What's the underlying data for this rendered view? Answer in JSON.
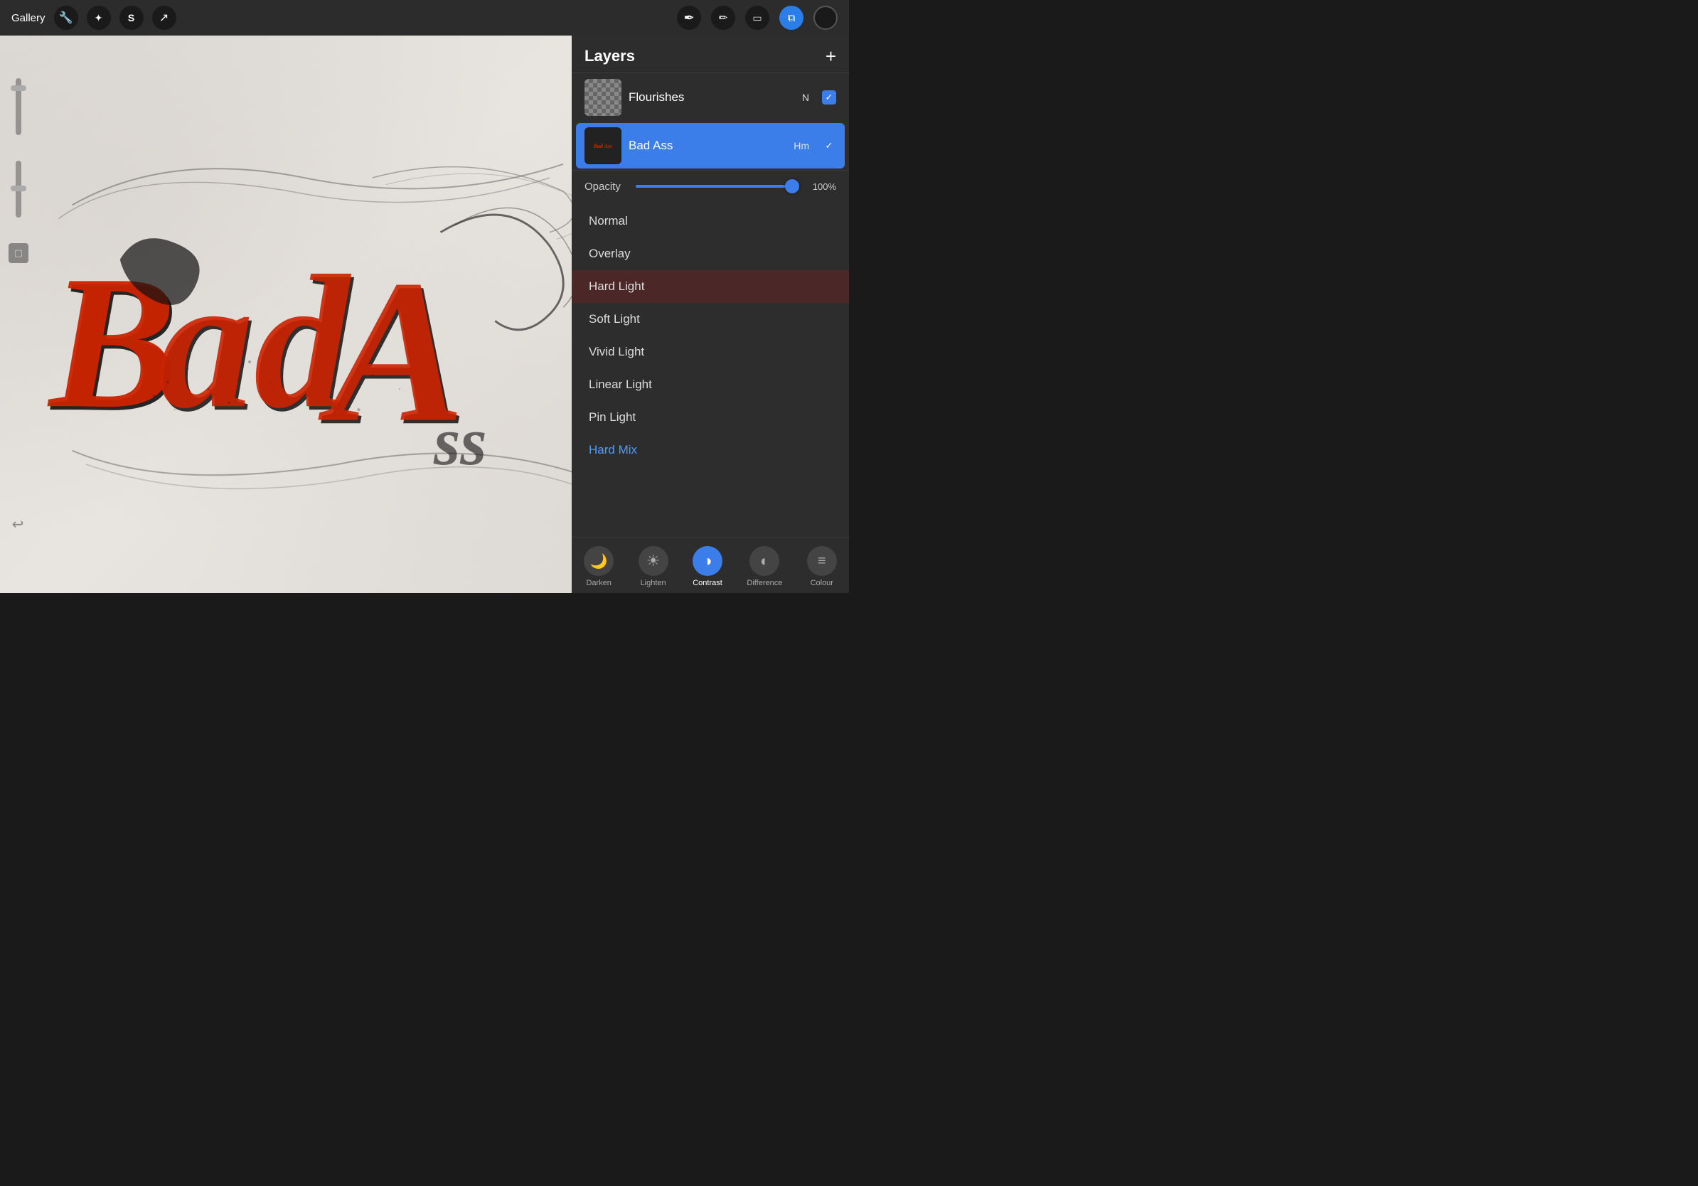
{
  "toolbar": {
    "gallery_label": "Gallery",
    "tools": [
      {
        "name": "wrench",
        "icon": "🔧",
        "active": false
      },
      {
        "name": "magic-wand",
        "icon": "✦",
        "active": false
      },
      {
        "name": "smudge",
        "icon": "S",
        "active": false
      },
      {
        "name": "cursor",
        "icon": "↗",
        "active": false
      }
    ],
    "right_tools": [
      {
        "name": "pen",
        "icon": "✒"
      },
      {
        "name": "eraser-pencil",
        "icon": "✏"
      },
      {
        "name": "eraser",
        "icon": "⬜"
      },
      {
        "name": "layers-icon",
        "icon": "⧉",
        "active": true
      }
    ],
    "color_dot": "#111"
  },
  "layers_panel": {
    "title": "Layers",
    "add_button": "+",
    "layers": [
      {
        "id": "flourishes",
        "name": "Flourishes",
        "mode_short": "N",
        "active": false,
        "checked": true,
        "thumb_type": "checker"
      },
      {
        "id": "bad-ass",
        "name": "Bad Ass",
        "mode_short": "Hm",
        "active": true,
        "checked": true,
        "thumb_type": "content"
      }
    ],
    "opacity": {
      "label": "Opacity",
      "value": 100,
      "value_display": "100%"
    },
    "blend_modes": [
      {
        "id": "normal",
        "name": "Normal",
        "selected": false,
        "highlighted": false
      },
      {
        "id": "overlay",
        "name": "Overlay",
        "selected": false,
        "highlighted": false
      },
      {
        "id": "hard-light",
        "name": "Hard Light",
        "selected": false,
        "highlighted": true
      },
      {
        "id": "soft-light",
        "name": "Soft Light",
        "selected": false,
        "highlighted": false
      },
      {
        "id": "vivid-light",
        "name": "Vivid Light",
        "selected": false,
        "highlighted": false
      },
      {
        "id": "linear-light",
        "name": "Linear Light",
        "selected": false,
        "highlighted": false
      },
      {
        "id": "pin-light",
        "name": "Pin Light",
        "selected": false,
        "highlighted": false
      },
      {
        "id": "hard-mix",
        "name": "Hard Mix",
        "selected": true,
        "highlighted": false
      }
    ],
    "categories": [
      {
        "id": "darken",
        "label": "Darken",
        "icon": "🌙",
        "active": false
      },
      {
        "id": "lighten",
        "label": "Lighten",
        "icon": "☀",
        "active": false
      },
      {
        "id": "contrast",
        "label": "Contrast",
        "icon": "◑",
        "active": true
      },
      {
        "id": "difference",
        "label": "Difference",
        "icon": "◐",
        "active": false
      },
      {
        "id": "colour",
        "label": "Colour",
        "icon": "≡",
        "active": false
      }
    ]
  },
  "canvas": {
    "text": "Bad Ass"
  }
}
